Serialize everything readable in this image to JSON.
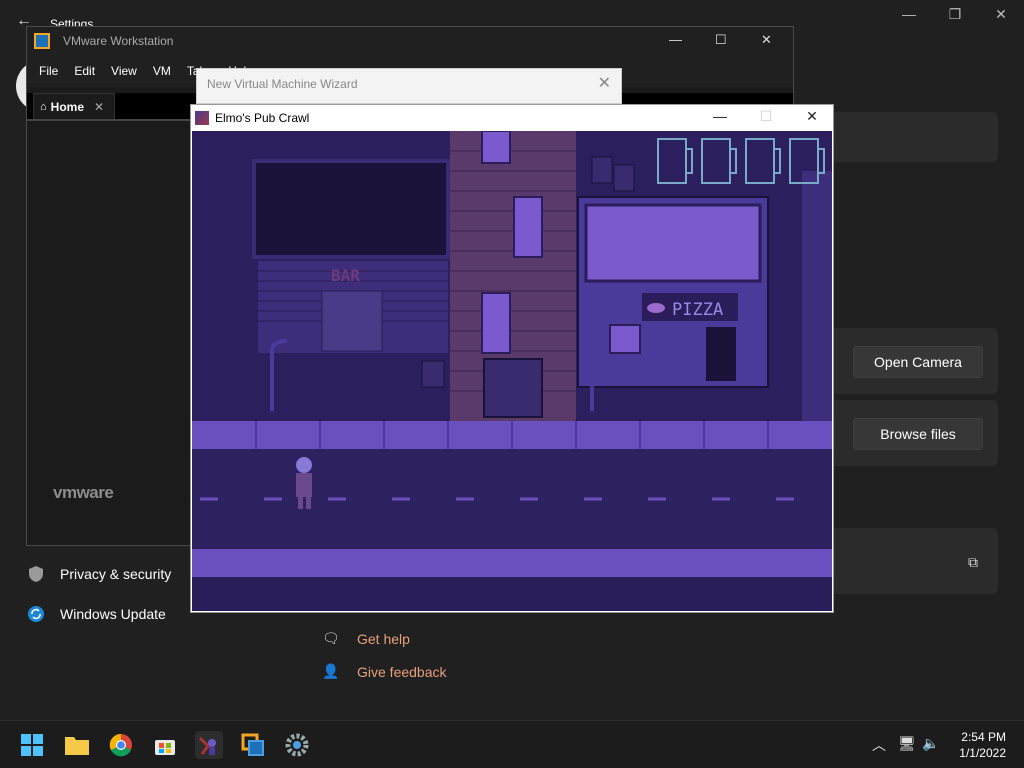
{
  "settings": {
    "title": "Settings",
    "nav": [
      {
        "label": "Privacy & security",
        "icon": "shield-icon"
      },
      {
        "label": "Windows Update",
        "icon": "update-icon"
      }
    ],
    "buttons": {
      "open_camera": "Open Camera",
      "browse_files": "Browse files"
    },
    "help": {
      "get_help": "Get help",
      "give_feedback": "Give feedback"
    }
  },
  "vmware": {
    "title": "VMware Workstation",
    "menu": [
      "File",
      "Edit",
      "View",
      "VM",
      "Tabs",
      "Help"
    ],
    "home_tab": "Home",
    "brand": "vmware"
  },
  "wizard": {
    "title": "New Virtual Machine Wizard"
  },
  "game": {
    "title": "Elmo's Pub Crawl",
    "signs": {
      "bar": "BAR",
      "pizza": "PIZZA"
    },
    "beer_mugs": 4
  },
  "taskbar": {
    "time": "2:54 PM",
    "date": "1/1/2022",
    "apps": [
      "start-icon",
      "file-explorer-icon",
      "chrome-icon",
      "store-icon",
      "elmo-game-icon",
      "vmware-icon",
      "settings-gear-icon"
    ]
  },
  "colors": {
    "accent_link": "#e6a07a",
    "game_bg": "#2a1d5a",
    "game_purple": "#6a4fbf"
  }
}
